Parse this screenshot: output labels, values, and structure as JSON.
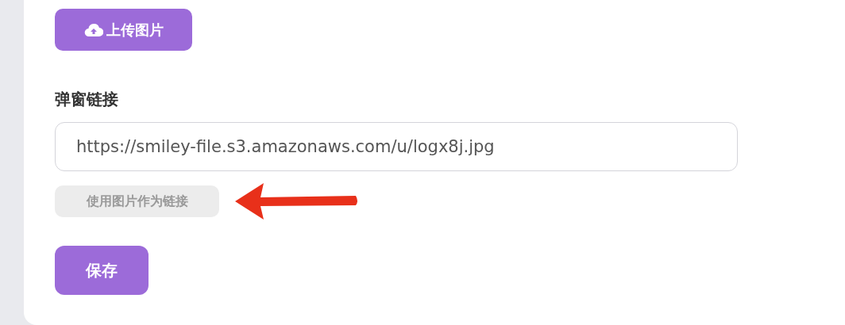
{
  "upload_button": {
    "label": "上传图片"
  },
  "popup_link": {
    "label": "弹窗链接",
    "value": "https://smiley-file.s3.amazonaws.com/u/logx8j.jpg",
    "use_image_chip": "使用图片作为链接"
  },
  "save_button": {
    "label": "保存"
  }
}
